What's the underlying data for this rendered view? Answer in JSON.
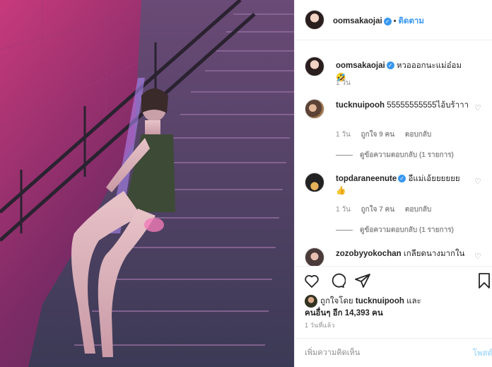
{
  "header": {
    "username": "oomsakaojai",
    "verified_icon": "verified-badge-icon",
    "separator": "•",
    "follow_label": "ติดตาม"
  },
  "caption": {
    "username": "oomsakaojai",
    "text": "หวอออกนะแม่อ๋อม 🤣",
    "time": "1 วัน"
  },
  "comments": [
    {
      "username": "tucknuipooh",
      "text": "55555555555ไอ้บร้าาา",
      "time": "1 วัน",
      "likes": "ถูกใจ 9 คน",
      "reply_label": "ตอบกลับ",
      "view_replies": "ดูข้อความตอบกลับ (1 รายการ)"
    },
    {
      "username": "topdaraneenute",
      "text": "อีแม่เอ้ยยยยยย 👍",
      "time": "1 วัน",
      "likes": "ถูกใจ 7 คน",
      "reply_label": "ตอบกลับ",
      "view_replies": "ดูข้อความตอบกลับ (1 รายการ)"
    },
    {
      "username": "zozobyyokochan",
      "text": "เกลียดนางมากใน"
    }
  ],
  "actions": {
    "like_icon": "heart-icon",
    "comment_icon": "comment-icon",
    "share_icon": "share-icon",
    "save_icon": "bookmark-icon"
  },
  "likes": {
    "prefix": "ถูกใจโดย",
    "user": "tucknuipooh",
    "conj": "และ",
    "others": "คนอื่นๆ อีก 14,393 คน"
  },
  "time_ago": "1 วันที่แล้ว",
  "add_comment": {
    "placeholder": "เพิ่มความคิดเห็น",
    "post_label": "โพสต์"
  },
  "colors": {
    "accent": "#3897f0",
    "post_disabled": "#b2dffc",
    "muted": "#8e8e8e"
  }
}
